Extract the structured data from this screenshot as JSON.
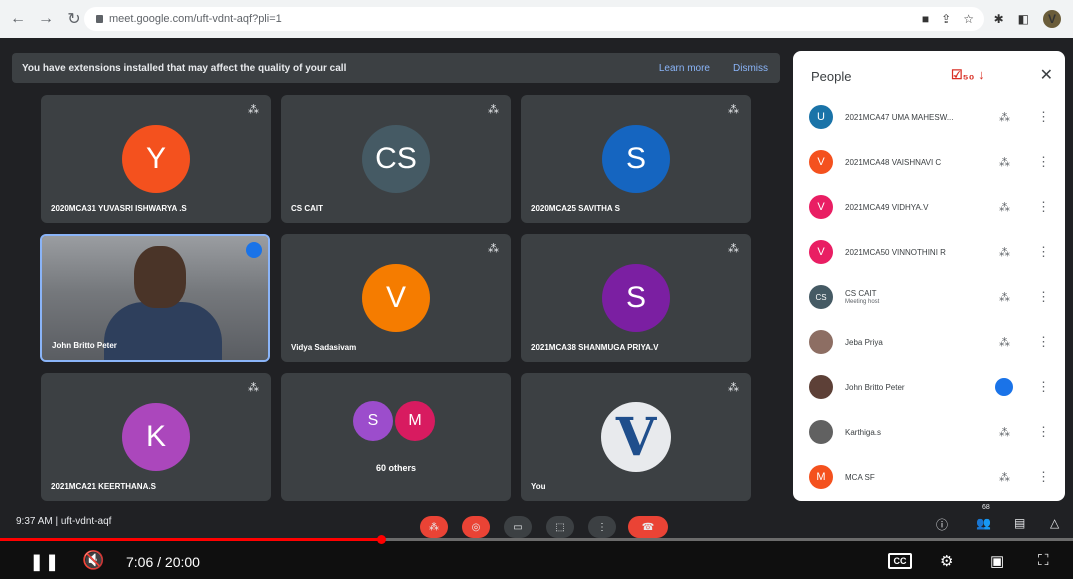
{
  "browser": {
    "url": "meet.google.com/uft-vdnt-aqf?pli=1",
    "avatar_letter": "V"
  },
  "notice": {
    "message": "You have extensions installed that may affect the quality of your call",
    "learn_more": "Learn more",
    "dismiss": "Dismiss"
  },
  "tiles": [
    {
      "name": "2020MCA31 YUVASRI ISHWARYA .S",
      "initial": "Y",
      "color": "#f4511e"
    },
    {
      "name": "CS CAIT",
      "initial": "CS",
      "color": "#455a64"
    },
    {
      "name": "2020MCA25 SAVITHA S",
      "initial": "S",
      "color": "#1565c0"
    },
    {
      "name": "John Britto Peter"
    },
    {
      "name": "Vidya Sadasivam",
      "initial": "V",
      "color": "#f57c00"
    },
    {
      "name": "2021MCA38 SHANMUGA PRIYA.V",
      "initial": "S",
      "color": "#7b1fa2"
    },
    {
      "name": "2021MCA21 KEERTHANA.S",
      "initial": "K",
      "color": "#ab47bc"
    },
    {
      "others": "60 others",
      "initial1": "S",
      "initial2": "M",
      "color1": "#9c4dcc",
      "color2": "#d81b60"
    },
    {
      "name": "You",
      "initial": "V"
    }
  ],
  "panel": {
    "title": "People",
    "annotation": "☑₅₀ ↓",
    "people": [
      {
        "name": "2021MCA47 UMA MAHESW...",
        "initial": "U",
        "color": "#1a73a8"
      },
      {
        "name": "2021MCA48 VAISHNAVI C",
        "initial": "V",
        "color": "#f4511e"
      },
      {
        "name": "2021MCA49 VIDHYA.V",
        "initial": "V",
        "color": "#e91e63"
      },
      {
        "name": "2021MCA50 VINNOTHINI R",
        "initial": "V",
        "color": "#e91e63"
      },
      {
        "name": "CS CAIT",
        "sub": "Meeting host",
        "initial": "CS",
        "color": "#455a64"
      },
      {
        "name": "Jeba Priya",
        "initial": "",
        "color": "#8d6e63"
      },
      {
        "name": "John Britto Peter",
        "initial": "",
        "color": "#5d4037"
      },
      {
        "name": "Karthiga.s",
        "initial": "",
        "color": "#616161"
      },
      {
        "name": "MCA SF",
        "initial": "M",
        "color": "#f4511e"
      }
    ]
  },
  "meet_bottom": {
    "time_code": "9:37 AM  |  uft-vdnt-aqf",
    "people_count": "68"
  },
  "player": {
    "current_time": "7:06 / 20:00",
    "progress": 0.355,
    "cc_label": "CC"
  }
}
